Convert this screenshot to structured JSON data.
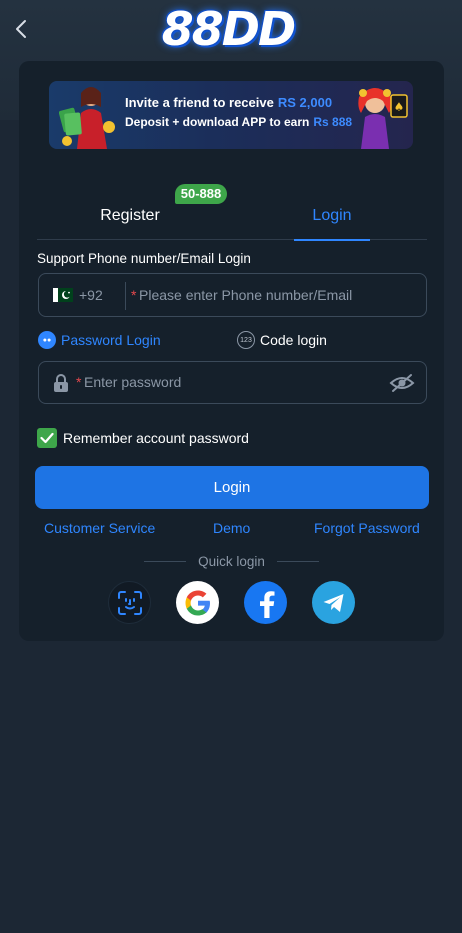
{
  "header": {
    "logo_text": "88DD",
    "back_icon": "chevron-left-icon"
  },
  "banner": {
    "line1_text": "Invite a friend to receive",
    "line1_amount": "RS 2,000",
    "line2_text": "Deposit + download APP to earn",
    "line2_amount": "Rs 888"
  },
  "tabs": {
    "register_label": "Register",
    "register_badge": "50-888",
    "login_label": "Login",
    "active": "login"
  },
  "form": {
    "section_label": "Support Phone number/Email Login",
    "country_code": "+92",
    "phone_placeholder": "Please enter Phone number/Email",
    "password_mode_label": "Password Login",
    "code_mode_label": "Code login",
    "code_mode_icon_text": "123",
    "password_placeholder": "Enter password",
    "required_mark": "*",
    "remember_label": "Remember account password",
    "remember_checked": true,
    "login_button": "Login"
  },
  "links": {
    "customer_service": "Customer Service",
    "demo": "Demo",
    "forgot_password": "Forgot Password"
  },
  "quick_login": {
    "label": "Quick login",
    "options": [
      "face-id-icon",
      "google-icon",
      "facebook-icon",
      "telegram-icon"
    ]
  },
  "colors": {
    "accent": "#2f86ff",
    "button": "#1e74e4",
    "success": "#3ea64a",
    "card": "#15202b",
    "background": "#1c2734"
  }
}
